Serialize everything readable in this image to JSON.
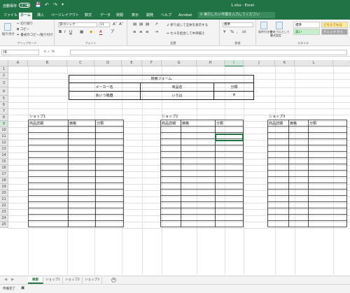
{
  "titlebar": {
    "autosave_label": "自動保存",
    "autosave_state": "オフ",
    "doc_title": "1.xlsx  -  Excel"
  },
  "ribbon_tabs": [
    "ファイル",
    "ホーム",
    "挿入",
    "ページレイアウト",
    "数式",
    "データ",
    "校閲",
    "表示",
    "開発",
    "ヘルプ",
    "Acrobat"
  ],
  "active_tab": "ホーム",
  "tell_me": "実行したい作業を入力してください",
  "clipboard": {
    "paste": "貼り付け",
    "cut": "切り取り",
    "copy": "コピー",
    "format_painter": "書式のコピー/貼り付け",
    "label": "クリップボード"
  },
  "font": {
    "name": "游ゴシック",
    "size": "11",
    "bold": "B",
    "italic": "I",
    "underline": "U",
    "label": "フォント"
  },
  "alignment": {
    "wrap": "折り返して全体を表示する",
    "merge": "セルを結合して中央揃え",
    "label": "配置"
  },
  "number": {
    "format": "標準",
    "label": "数値"
  },
  "styles": {
    "conditional": "条件付き書式",
    "as_table": "テーブルとして書式設定",
    "normal": "標準",
    "good": "良い",
    "neutral": "どちらでもな",
    "check_cell": "チェック セル",
    "label": "スタイル"
  },
  "formula_bar": {
    "name_box": "I9",
    "cancel": "×",
    "enter": "✓",
    "fx": "fx",
    "formula": ""
  },
  "columns": [
    "A",
    "B",
    "C",
    "D",
    "E",
    "F",
    "G",
    "H",
    "I",
    "J",
    "K",
    "L",
    "M"
  ],
  "rows": [
    "1",
    "2",
    "3",
    "4",
    "5",
    "6",
    "7",
    "8",
    "9",
    "10",
    "11",
    "12",
    "13",
    "14",
    "15",
    "16",
    "17",
    "18",
    "19",
    "20",
    "21",
    "22",
    "23",
    "24",
    "25"
  ],
  "search_form": {
    "title": "検索フォーム",
    "headers": [
      "メーカー名",
      "商品名",
      "分類"
    ],
    "values": [
      "あいう機器",
      "いろは",
      "A"
    ]
  },
  "shops": [
    {
      "title": "ショップ1",
      "headers": [
        "商品詳細",
        "価格",
        "分類"
      ]
    },
    {
      "title": "ショップ2",
      "headers": [
        "商品詳細",
        "価格",
        "分類"
      ]
    },
    {
      "title": "ショップ3",
      "headers": [
        "商品詳細",
        "価格",
        "分類"
      ]
    }
  ],
  "sheets": [
    "検索",
    "ショップ1",
    "ショップ2",
    "ショップ3"
  ],
  "active_sheet": "検索",
  "status": {
    "ready": "準備完了"
  },
  "colors": {
    "excel_green": "#217346"
  }
}
